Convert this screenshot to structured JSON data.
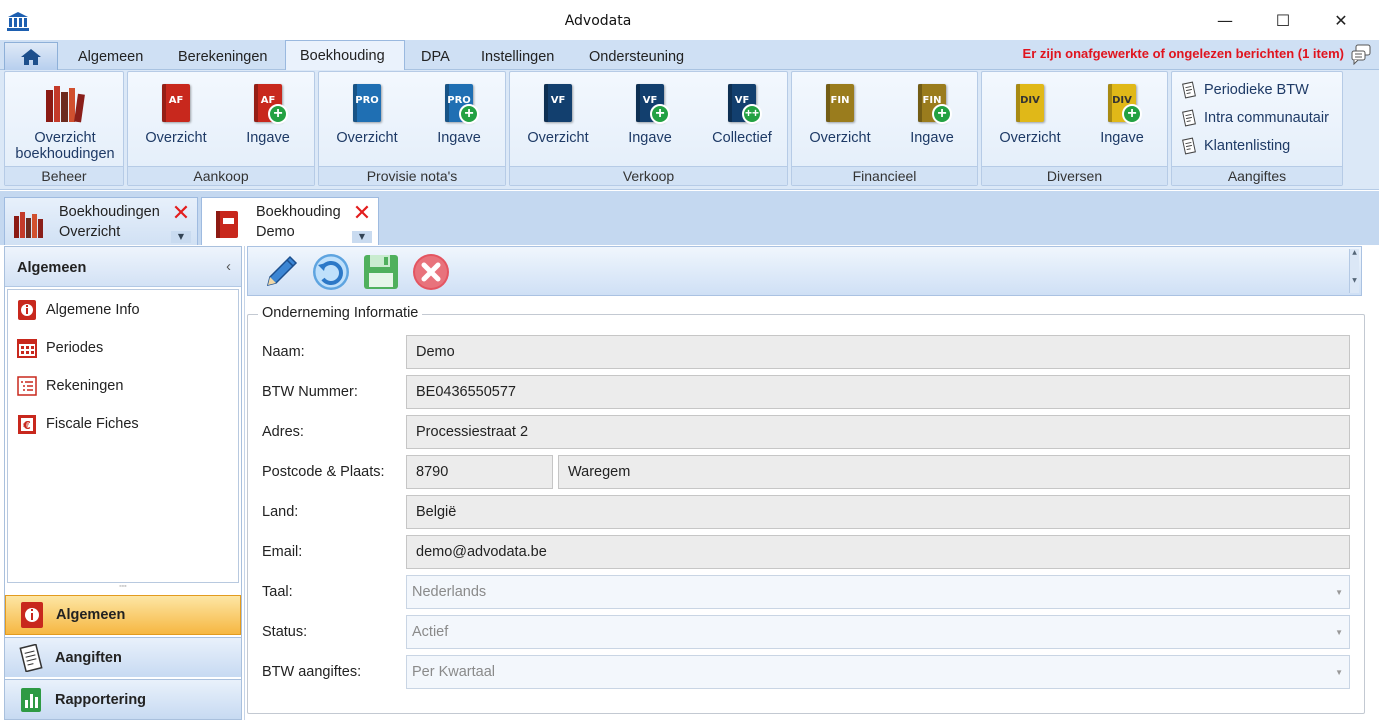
{
  "window": {
    "title": "Advodata",
    "minimize": "—",
    "maximize": "☐",
    "close": "✕"
  },
  "ribbon_tabs": [
    "Algemeen",
    "Berekeningen",
    "Boekhouding",
    "DPA",
    "Instellingen",
    "Ondersteuning"
  ],
  "ribbon_message": "Er zijn onafgewerkte of ongelezen berichten (1 item)",
  "groups": {
    "beheer": {
      "label": "Beheer",
      "btn1_line1": "Overzicht",
      "btn1_line2": "boekhoudingen"
    },
    "aankoop": {
      "label": "Aankoop",
      "overzicht": "Overzicht",
      "ingave": "Ingave",
      "code": "AF"
    },
    "provisie": {
      "label": "Provisie nota's",
      "overzicht": "Overzicht",
      "ingave": "Ingave",
      "code": "PRO"
    },
    "verkoop": {
      "label": "Verkoop",
      "overzicht": "Overzicht",
      "ingave": "Ingave",
      "collectief": "Collectief",
      "code": "VF"
    },
    "financieel": {
      "label": "Financieel",
      "overzicht": "Overzicht",
      "ingave": "Ingave",
      "code": "FIN"
    },
    "diversen": {
      "label": "Diversen",
      "overzicht": "Overzicht",
      "ingave": "Ingave",
      "code": "DIV"
    },
    "aangiftes": {
      "label": "Aangiftes",
      "items": [
        "Periodieke BTW",
        "Intra communautair",
        "Klantenlisting"
      ]
    }
  },
  "doc_tabs": [
    {
      "line1": "Boekhoudingen",
      "line2": "Overzicht"
    },
    {
      "line1": "Boekhouding",
      "line2": "Demo"
    }
  ],
  "left_panel": {
    "header": "Algemeen",
    "collapse": "‹",
    "items": [
      "Algemene Info",
      "Periodes",
      "Rekeningen",
      "Fiscale Fiches"
    ],
    "splitter": "ꞌꞌꞌꞌ",
    "nav": [
      "Algemeen",
      "Aangiften",
      "Rapportering"
    ]
  },
  "form": {
    "legend": "Onderneming Informatie",
    "labels": {
      "naam": "Naam:",
      "btw": "BTW Nummer:",
      "adres": "Adres:",
      "postcode": "Postcode & Plaats:",
      "land": "Land:",
      "email": "Email:",
      "taal": "Taal:",
      "status": "Status:",
      "aangiftes": "BTW aangiftes:"
    },
    "values": {
      "naam": "Demo",
      "btw": "BE0436550577",
      "adres": "Processiestraat 2",
      "postcode": "8790",
      "plaats": "Waregem",
      "land": "België",
      "email": "demo@advodata.be",
      "taal": "Nederlands",
      "status": "Actief",
      "aangiftes": "Per Kwartaal"
    }
  },
  "colors": {
    "accent": "#1e3a66",
    "alert": "#e0141e",
    "active_nav": "#f6b742",
    "aankoop": "#c8281d",
    "provisie": "#1f6fb3",
    "verkoop": "#123f6e",
    "financieel": "#9a7c1d",
    "diversen": "#e0b818"
  }
}
